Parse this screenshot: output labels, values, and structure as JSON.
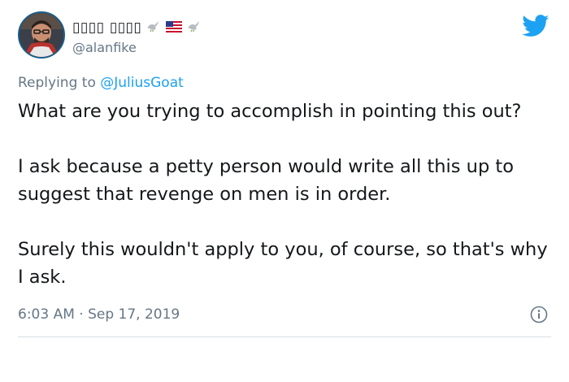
{
  "author": {
    "display_name": "▯▯▯▯ ▯▯▯▯",
    "handle": "@alanfike",
    "badge_icons": [
      "dove-emoji",
      "us-flag-emoji",
      "dove-emoji"
    ]
  },
  "reply": {
    "prefix": "Replying to ",
    "mention": "@JuliusGoat"
  },
  "tweet": {
    "paragraphs": [
      "What are you trying to accomplish in pointing this out?",
      "I ask because a petty person would write all this up to suggest that revenge on men is in order.",
      "Surely this wouldn't apply to you, of course, so that's why I ask."
    ],
    "timestamp": "6:03 AM · Sep 17, 2019"
  },
  "colors": {
    "twitter_blue": "#1da1f2",
    "secondary_text": "#657786",
    "primary_text": "#14171a"
  },
  "icons": {
    "logo": "twitter-bird-icon",
    "info": "info-icon",
    "avatar": "avatar"
  }
}
